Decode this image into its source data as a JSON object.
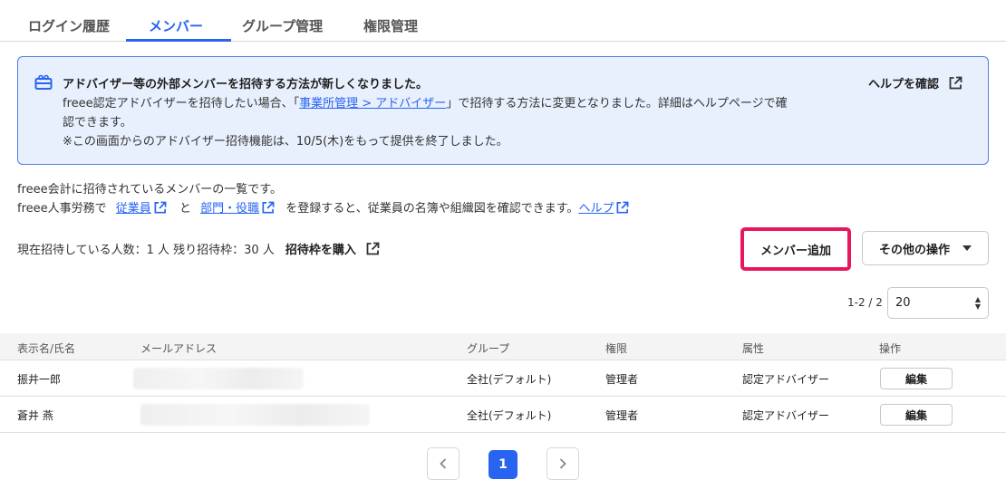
{
  "tabs": [
    {
      "label": "ログイン履歴",
      "active": false
    },
    {
      "label": "メンバー",
      "active": true
    },
    {
      "label": "グループ管理",
      "active": false
    },
    {
      "label": "権限管理",
      "active": false
    }
  ],
  "notice": {
    "icon": "gift-card-icon",
    "title": "アドバイザー等の外部メンバーを招待する方法が新しくなりました。",
    "line1_before": "freee認定アドバイザーを招待したい場合、「",
    "line1_link": "事業所管理 > アドバイザー",
    "line1_after": "」で招待する方法に変更となりました。詳細はヘルプページで確",
    "line2": "認できます。",
    "line3": "※この画面からのアドバイザー招待機能は、10/5(木)をもって提供を終了しました。",
    "help_label": "ヘルプを確認"
  },
  "description": {
    "line1": "freee会計に招待されているメンバーの一覧です。",
    "line2_prefix": "freee人事労務で",
    "link_employees": "従業員",
    "connector": "と",
    "link_departments": "部門・役職",
    "line2_middle": "を登録すると、従業員の名簿や組織図を確認できます。",
    "link_help": "ヘルプ"
  },
  "quota": {
    "text": "現在招待している人数：1 人 残り招待枠：30 人",
    "buy_label": "招待枠を購入"
  },
  "actions": {
    "add_member_label": "メンバー追加",
    "other_label": "その他の操作"
  },
  "pagination": {
    "range": "1-2 / 2",
    "page_size": "20",
    "current_page": "1"
  },
  "table": {
    "headers": [
      "表示名/氏名",
      "メールアドレス",
      "グループ",
      "権限",
      "属性",
      "操作"
    ],
    "rows": [
      {
        "name": "振井一郎",
        "email": "",
        "group": "全社(デフォルト)",
        "role": "管理者",
        "attribute": "認定アドバイザー",
        "action": "編集"
      },
      {
        "name": "蒼井 燕",
        "email": "",
        "group": "全社(デフォルト)",
        "role": "管理者",
        "attribute": "認定アドバイザー",
        "action": "編集"
      }
    ]
  },
  "colors": {
    "accent": "#2864f0",
    "highlight": "#e8175d",
    "notice_bg": "#e8f0fd"
  }
}
